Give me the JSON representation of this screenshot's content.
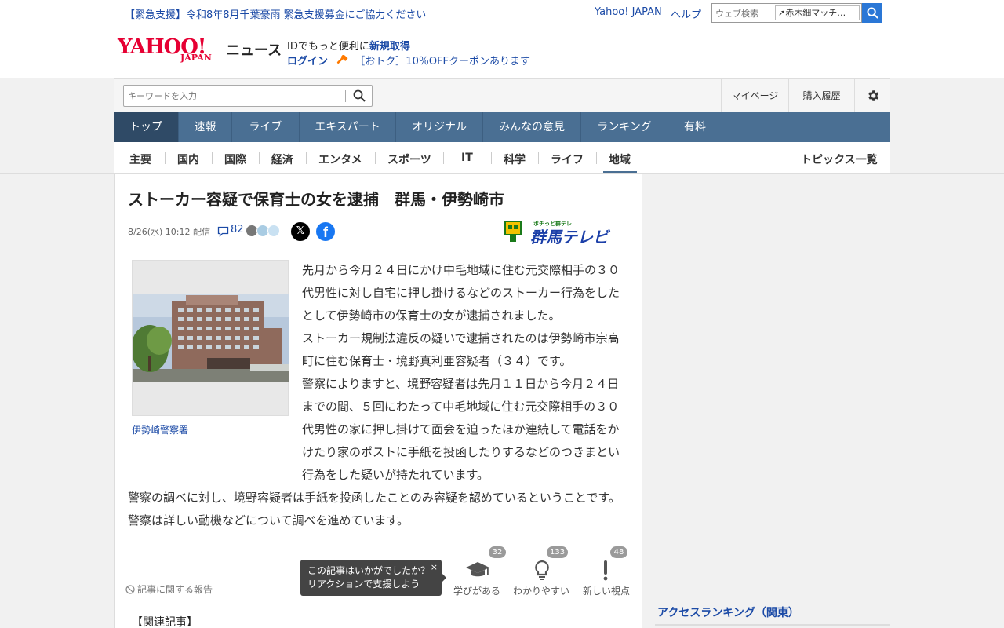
{
  "header": {
    "emergency_text": "【緊急支援】令和8年8月千葉豪雨 緊急支援募金にご協力ください",
    "yahoo_japan_link": "Yahoo! JAPAN",
    "help_link": "ヘルプ",
    "web_search_placeholder": "ウェブ検索",
    "trend_word": "赤木細マッチ…",
    "logo_yahoo": "YAHOO!",
    "logo_japan": "JAPAN",
    "logo_news": "ニュース",
    "promo_line1_prefix": "IDでもっと便利に",
    "promo_line1_link": "新規取得",
    "promo_login": "ログイン",
    "promo_coupon": "［おトク］10％OFFクーポンあります"
  },
  "toolbar": {
    "keyword_placeholder": "キーワードを入力",
    "mypage": "マイページ",
    "purchase_history": "購入履歴"
  },
  "nav": {
    "items": [
      "トップ",
      "速報",
      "ライブ",
      "エキスパート",
      "オリジナル",
      "みんなの意見",
      "ランキング",
      "有料"
    ]
  },
  "subnav": {
    "items": [
      "主要",
      "国内",
      "国際",
      "経済",
      "エンタメ",
      "スポーツ",
      "IT",
      "科学",
      "ライフ",
      "地域"
    ],
    "topics_link": "トピックス一覧"
  },
  "article": {
    "title": "ストーカー容疑で保育士の女を逮捕　群馬・伊勢崎市",
    "date": "8/26(水) 10:12",
    "delivered": "配信",
    "comment_count": "82",
    "source_name": "群馬テレビ",
    "source_tag": "ポチっと群テレ",
    "photo_caption": "伊勢崎警察署",
    "paragraphs": [
      "先月から今月２４日にかけ中毛地域に住む元交際相手の３０代男性に対し自宅に押し掛けるなどのストーカー行為をしたとして伊勢崎市の保育士の女が逮捕されました。",
      "ストーカー規制法違反の疑いで逮捕されたのは伊勢崎市宗高町に住む保育士・境野真利亜容疑者（３４）です。",
      "警察によりますと、境野容疑者は先月１１日から今月２４日までの間、５回にわたって中毛地域に住む元交際相手の３０代男性の家に押し掛けて面会を迫ったほか連続して電話をかけたり家のポストに手紙を投函したりするなどのつきまとい行為をした疑いが持たれています。",
      "警察の調べに対し、境野容疑者は手紙を投函したことのみ容疑を認めているということです。警察は詳しい動機などについて調べを進めています。"
    ],
    "report_link": "記事に関する報告",
    "tooltip_line1": "この記事はいかがでしたか？",
    "tooltip_line2": "リアクションで支援しよう",
    "tooltip_close": "×",
    "reactions": [
      {
        "label": "学びがある",
        "count": "32",
        "icon": "graduation-cap-icon"
      },
      {
        "label": "わかりやすい",
        "count": "133",
        "icon": "lightbulb-icon"
      },
      {
        "label": "新しい視点",
        "count": "48",
        "icon": "exclamation-icon"
      }
    ],
    "related_heading": "【関連記事】"
  },
  "sidebar": {
    "ranking_title": "アクセスランキング（関東）"
  },
  "colors": {
    "nav_bg": "#4a6f93",
    "nav_active": "#2f4a66",
    "link_blue": "#1b4aa6",
    "yahoo_red": "#e60033",
    "search_blue": "#2a77d6"
  }
}
